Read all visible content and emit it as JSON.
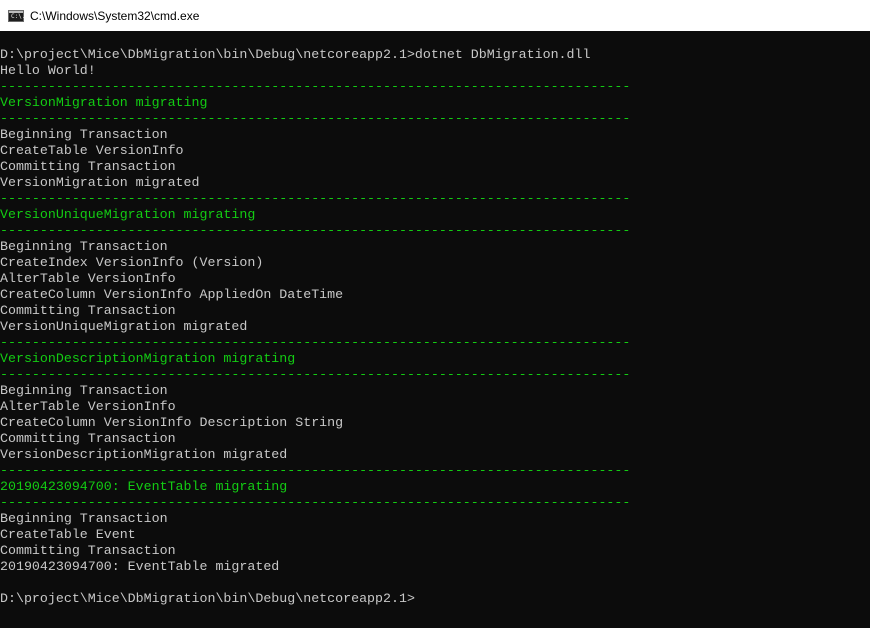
{
  "window": {
    "title": "C:\\Windows\\System32\\cmd.exe",
    "icon": "console-icon",
    "icon_glyph": "C:\\."
  },
  "colors": {
    "background": "#0c0c0c",
    "text": "#c8c8c8",
    "green": "#13cc13"
  },
  "console": {
    "lines": [
      {
        "text": "D:\\project\\Mice\\DbMigration\\bin\\Debug\\netcoreapp2.1>dotnet DbMigration.dll",
        "style": "white"
      },
      {
        "text": "Hello World!",
        "style": "white"
      },
      {
        "text": "-------------------------------------------------------------------------------",
        "style": "green"
      },
      {
        "text": "VersionMigration migrating",
        "style": "green"
      },
      {
        "text": "-------------------------------------------------------------------------------",
        "style": "green"
      },
      {
        "text": "Beginning Transaction",
        "style": "white"
      },
      {
        "text": "CreateTable VersionInfo",
        "style": "white"
      },
      {
        "text": "Committing Transaction",
        "style": "white"
      },
      {
        "text": "VersionMigration migrated",
        "style": "white"
      },
      {
        "text": "-------------------------------------------------------------------------------",
        "style": "green"
      },
      {
        "text": "VersionUniqueMigration migrating",
        "style": "green"
      },
      {
        "text": "-------------------------------------------------------------------------------",
        "style": "green"
      },
      {
        "text": "Beginning Transaction",
        "style": "white"
      },
      {
        "text": "CreateIndex VersionInfo (Version)",
        "style": "white"
      },
      {
        "text": "AlterTable VersionInfo",
        "style": "white"
      },
      {
        "text": "CreateColumn VersionInfo AppliedOn DateTime",
        "style": "white"
      },
      {
        "text": "Committing Transaction",
        "style": "white"
      },
      {
        "text": "VersionUniqueMigration migrated",
        "style": "white"
      },
      {
        "text": "-------------------------------------------------------------------------------",
        "style": "green"
      },
      {
        "text": "VersionDescriptionMigration migrating",
        "style": "green"
      },
      {
        "text": "-------------------------------------------------------------------------------",
        "style": "green"
      },
      {
        "text": "Beginning Transaction",
        "style": "white"
      },
      {
        "text": "AlterTable VersionInfo",
        "style": "white"
      },
      {
        "text": "CreateColumn VersionInfo Description String",
        "style": "white"
      },
      {
        "text": "Committing Transaction",
        "style": "white"
      },
      {
        "text": "VersionDescriptionMigration migrated",
        "style": "white"
      },
      {
        "text": "-------------------------------------------------------------------------------",
        "style": "green"
      },
      {
        "text": "20190423094700: EventTable migrating",
        "style": "green"
      },
      {
        "text": "-------------------------------------------------------------------------------",
        "style": "green"
      },
      {
        "text": "Beginning Transaction",
        "style": "white"
      },
      {
        "text": "CreateTable Event",
        "style": "white"
      },
      {
        "text": "Committing Transaction",
        "style": "white"
      },
      {
        "text": "20190423094700: EventTable migrated",
        "style": "white"
      },
      {
        "text": "",
        "style": "white"
      },
      {
        "text": "D:\\project\\Mice\\DbMigration\\bin\\Debug\\netcoreapp2.1>",
        "style": "prompt"
      }
    ]
  }
}
